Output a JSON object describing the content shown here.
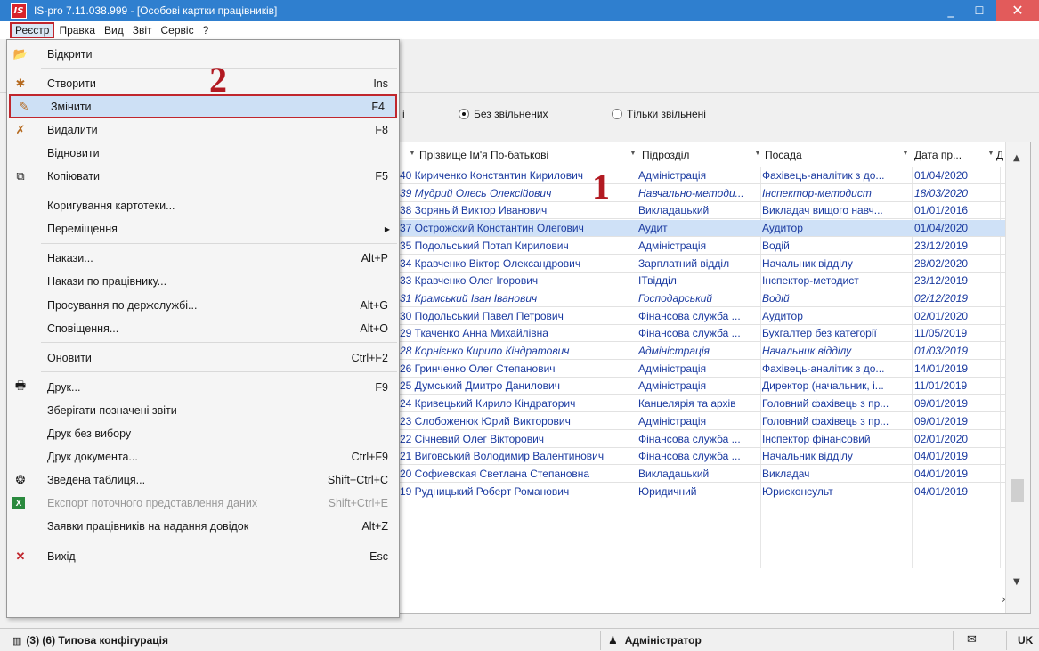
{
  "window": {
    "title": "IS-pro 7.11.038.999 - [Особові картки працівників]",
    "logo_text": "IS",
    "minimize": "_",
    "maximize": "☐",
    "close": "✕"
  },
  "menubar": [
    "Реєстр",
    "Правка",
    "Вид",
    "Звіт",
    "Сервіс",
    "?"
  ],
  "filters": {
    "cut_label": "і",
    "option_without_fired": "Без звільнених",
    "option_only_fired": "Тільки звільнені",
    "selected": "Без звільнених"
  },
  "grid": {
    "columns": [
      "Прізвище Ім'я По-батькові",
      "Підрозділ",
      "Посада",
      "Дата пр...",
      "Д"
    ],
    "rows": [
      {
        "name": "40 Кириченко Константин Кирилович",
        "dept": "Адміністрація",
        "pos": "Фахівець-аналітик з до...",
        "date": "01/04/2020"
      },
      {
        "name": "39 Мудрий Олесь Олексійович",
        "dept": "Навчально-методи...",
        "pos": "Інспектор-методист",
        "date": "18/03/2020",
        "italic": true
      },
      {
        "name": "38 Зоряный Виктор Иванович",
        "dept": "Викладацький",
        "pos": "Викладач вищого навч...",
        "date": "01/01/2016"
      },
      {
        "name": "37 Острожский Константин Олегович",
        "dept": "Аудит",
        "pos": "Аудитор",
        "date": "01/04/2020",
        "selected": true
      },
      {
        "name": "35 Подольський Потап Кирилович",
        "dept": "Адміністрація",
        "pos": "Водій",
        "date": "23/12/2019"
      },
      {
        "name": "34 Кравченко Віктор Олександрович",
        "dept": "Зарплатний відділ",
        "pos": "Начальник відділу",
        "date": "28/02/2020"
      },
      {
        "name": "33 Кравченко Олег Ігорович",
        "dept": "ІТвідділ",
        "pos": "Інспектор-методист",
        "date": "23/12/2019"
      },
      {
        "name": "31 Крамський Іван Іванович",
        "dept": "Господарський",
        "pos": "Водій",
        "date": "02/12/2019",
        "italic": true
      },
      {
        "name": "30 Подольський Павел Петрович",
        "dept": "Фінансова служба ...",
        "pos": "Аудитор",
        "date": "02/01/2020"
      },
      {
        "name": "29 Ткаченко Анна Михайлівна",
        "dept": "Фінансова служба ...",
        "pos": "Бухгалтер без категорії",
        "date": "11/05/2019"
      },
      {
        "name": "28 Корнієнко Кирило Кіндратович",
        "dept": "Адміністрація",
        "pos": "Начальник відділу",
        "date": "01/03/2019",
        "italic": true
      },
      {
        "name": "26 Гринченко Олег Степанович",
        "dept": "Адміністрація",
        "pos": "Фахівець-аналітик з до...",
        "date": "14/01/2019"
      },
      {
        "name": "25 Думський Дмитро Данилович",
        "dept": "Адміністрація",
        "pos": "Директор (начальник, і...",
        "date": "11/01/2019"
      },
      {
        "name": "24 Кривецький Кирило Кіндраторич",
        "dept": "Канцелярія та архів",
        "pos": "Головний фахівець з пр...",
        "date": "09/01/2019"
      },
      {
        "name": "23 Слобоженюк Юрий Викторович",
        "dept": "Адміністрація",
        "pos": "Головний фахівець з пр...",
        "date": "09/01/2019"
      },
      {
        "name": "22 Січневий Олег Вікторович",
        "dept": "Фінансова служба ...",
        "pos": "Інспектор фінансовий",
        "date": "02/01/2020"
      },
      {
        "name": "21 Виговський Володимир Валентинович",
        "dept": "Фінансова служба ...",
        "pos": "Начальник відділу",
        "date": "04/01/2019"
      },
      {
        "name": "20 Софиевская Светлана Степановна",
        "dept": "Викладацький",
        "pos": "Викладач",
        "date": "04/01/2019"
      },
      {
        "name": "19 Рудницький Роберт Романович",
        "dept": "Юридичний",
        "pos": "Юрисконсульт",
        "date": "04/01/2019"
      }
    ]
  },
  "dropdown": [
    {
      "label": "Відкрити",
      "shortcut": "",
      "icon": "folder-open-icon",
      "glyph": "📂"
    },
    {
      "sep": true
    },
    {
      "label": "Створити",
      "shortcut": "Ins",
      "icon": "new-doc-icon",
      "glyph": "✱"
    },
    {
      "label": "Змінити",
      "shortcut": "F4",
      "icon": "edit-doc-icon",
      "glyph": "✎",
      "highlight": true
    },
    {
      "label": "Видалити",
      "shortcut": "F8",
      "icon": "delete-doc-icon",
      "glyph": "✗"
    },
    {
      "label": "Відновити",
      "shortcut": "",
      "icon": "",
      "glyph": ""
    },
    {
      "label": "Копіювати",
      "shortcut": "F5",
      "icon": "copy-icon",
      "glyph": "⧉"
    },
    {
      "sep": true
    },
    {
      "label": "Коригування картотеки...",
      "shortcut": "",
      "icon": "",
      "glyph": ""
    },
    {
      "label": "Переміщення",
      "shortcut": "",
      "icon": "",
      "glyph": "",
      "submenu": true
    },
    {
      "sep": true
    },
    {
      "label": "Накази...",
      "shortcut": "Alt+P",
      "icon": "",
      "glyph": ""
    },
    {
      "label": "Накази по працівнику...",
      "shortcut": "",
      "icon": "",
      "glyph": ""
    },
    {
      "label": "Просування по держслужбі...",
      "shortcut": "Alt+G",
      "icon": "",
      "glyph": ""
    },
    {
      "label": "Сповіщення...",
      "shortcut": "Alt+O",
      "icon": "",
      "glyph": ""
    },
    {
      "sep": true
    },
    {
      "label": "Оновити",
      "shortcut": "Ctrl+F2",
      "icon": "",
      "glyph": ""
    },
    {
      "sep": true
    },
    {
      "label": "Друк...",
      "shortcut": "F9",
      "icon": "printer-icon",
      "glyph": "🖶"
    },
    {
      "label": "Зберігати позначені звіти",
      "shortcut": "",
      "icon": "",
      "glyph": ""
    },
    {
      "label": "Друк без вибору",
      "shortcut": "",
      "icon": "",
      "glyph": ""
    },
    {
      "label": "Друк документа...",
      "shortcut": "Ctrl+F9",
      "icon": "",
      "glyph": ""
    },
    {
      "label": "Зведена таблиця...",
      "shortcut": "Shift+Ctrl+C",
      "icon": "pivot-table-icon",
      "glyph": "❂"
    },
    {
      "label": "Експорт поточного представлення даних",
      "shortcut": "Shift+Ctrl+E",
      "icon": "excel-export-icon",
      "glyph": "X",
      "disabled": true
    },
    {
      "label": "Заявки працівників на надання довідок",
      "shortcut": "Alt+Z",
      "icon": "",
      "glyph": ""
    },
    {
      "sep": true
    },
    {
      "label": "Вихід",
      "shortcut": "Esc",
      "icon": "exit-icon",
      "glyph": "✕"
    }
  ],
  "annotations": {
    "step1": "1",
    "step2": "2"
  },
  "statusbar": {
    "config": "(3) (6) Типова конфігурація",
    "user": "Адміністратор",
    "lang": "UK"
  },
  "colors": {
    "accent": "#2f7fcf",
    "highlight_border": "#c0262d",
    "selection": "#cfe1f7"
  }
}
